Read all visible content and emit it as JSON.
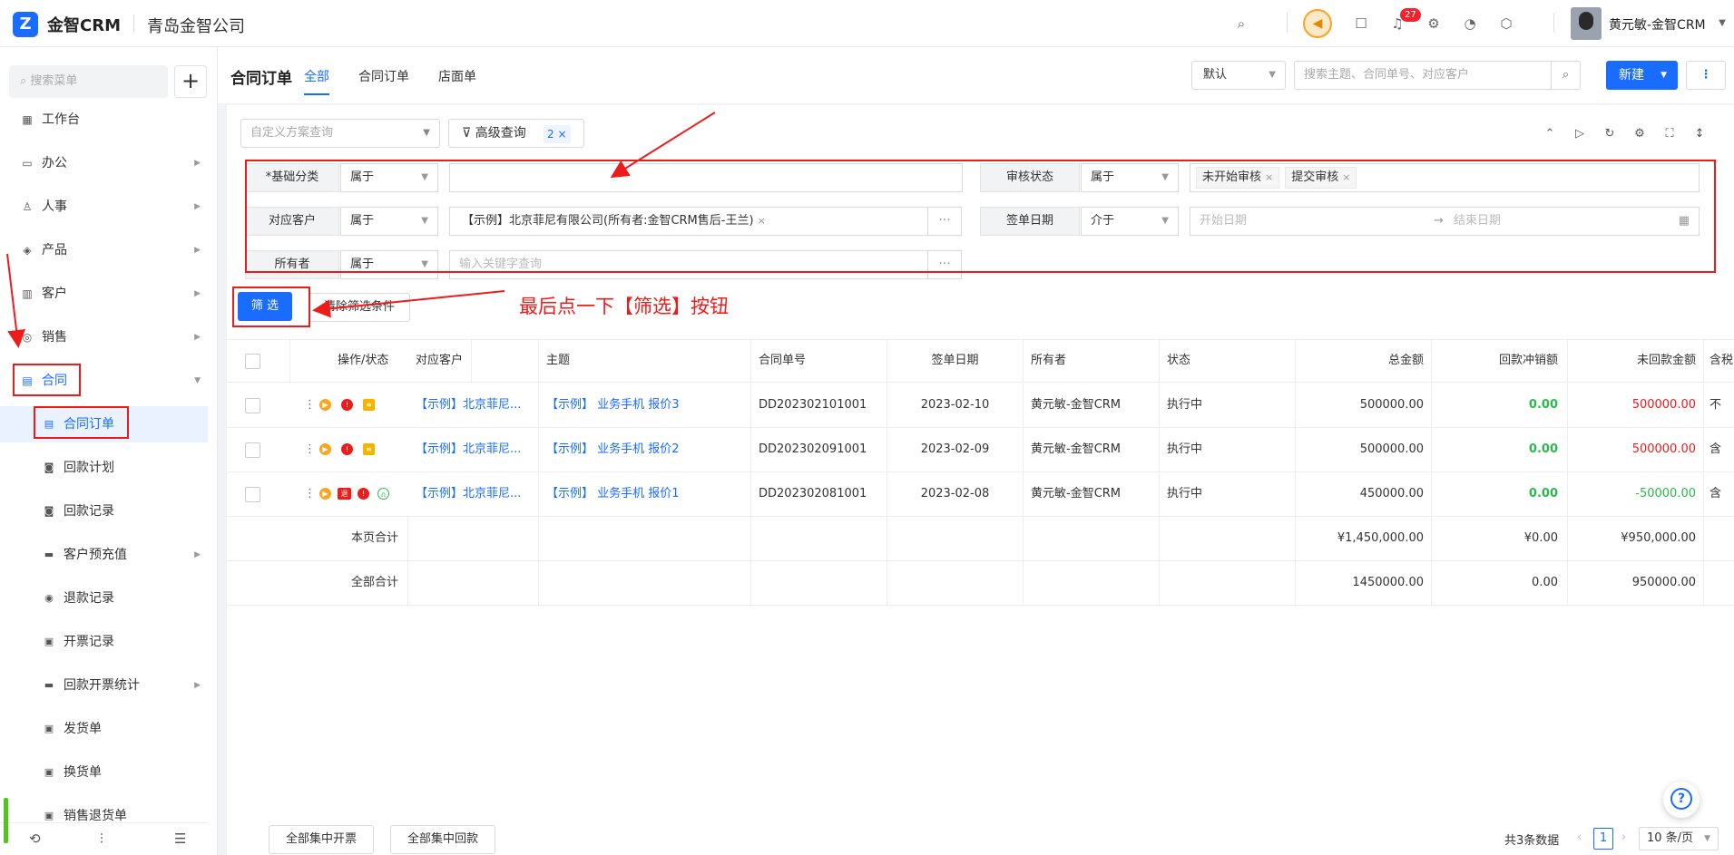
{
  "app": {
    "name": "金智CRM",
    "company": "青岛金智公司",
    "user": "黄元敏-金智CRM",
    "notif_count": "27"
  },
  "sidebar": {
    "search_placeholder": "搜索菜单",
    "items": [
      {
        "label": "工作台",
        "icon": "dashboard-icon"
      },
      {
        "label": "办公",
        "icon": "office-icon"
      },
      {
        "label": "人事",
        "icon": "people-icon"
      },
      {
        "label": "产品",
        "icon": "product-icon"
      },
      {
        "label": "客户",
        "icon": "customer-icon"
      },
      {
        "label": "销售",
        "icon": "sales-icon"
      },
      {
        "label": "合同",
        "icon": "contract-icon"
      }
    ],
    "subs": [
      {
        "label": "合同订单"
      },
      {
        "label": "回款计划"
      },
      {
        "label": "回款记录"
      },
      {
        "label": "客户预充值"
      },
      {
        "label": "退款记录"
      },
      {
        "label": "开票记录"
      },
      {
        "label": "回款开票统计"
      },
      {
        "label": "发货单"
      },
      {
        "label": "换货单"
      },
      {
        "label": "销售退货单"
      }
    ]
  },
  "header": {
    "title": "合同订单",
    "tabs": [
      {
        "label": "全部"
      },
      {
        "label": "合同订单"
      },
      {
        "label": "店面单"
      }
    ],
    "view_select": "默认",
    "search_placeholder": "搜索主题、合同单号、对应客户",
    "new_label": "新建"
  },
  "filters": {
    "scheme_placeholder": "自定义方案查询",
    "advanced_label": "高级查询",
    "advanced_count": "2",
    "rows": [
      {
        "label": "*基础分类",
        "op": "属于",
        "value": ""
      },
      {
        "label": "对应客户",
        "op": "属于",
        "value": "【示例】北京菲尼有限公司(所有者:金智CRM售后-王兰)"
      },
      {
        "label": "所有者",
        "op": "属于",
        "placeholder": "输入关键字查询"
      },
      {
        "label": "审核状态",
        "op": "属于",
        "tags": [
          "未开始审核",
          "提交审核"
        ]
      },
      {
        "label": "签单日期",
        "op": "介于",
        "start_placeholder": "开始日期",
        "end_placeholder": "结束日期"
      }
    ],
    "filter_btn": "筛 选",
    "clear_btn": "清除筛选条件",
    "annotation": "最后点一下【筛选】按钮"
  },
  "table": {
    "headers": [
      "操作/状态",
      "对应客户",
      "主题",
      "合同单号",
      "签单日期",
      "所有者",
      "状态",
      "总金额",
      "回款冲销额",
      "未回款金额",
      "含税"
    ],
    "rows": [
      {
        "customer": "【示例】北京菲尼...",
        "subject": "【示例】 业务手机 报价3",
        "no": "DD202302101001",
        "date": "2023-02-10",
        "owner": "黄元敏-金智CRM",
        "status": "执行中",
        "total": "500000.00",
        "paid": "0.00",
        "unpaid": "500000.00",
        "tax": "不"
      },
      {
        "customer": "【示例】北京菲尼...",
        "subject": "【示例】 业务手机 报价2",
        "no": "DD202302091001",
        "date": "2023-02-09",
        "owner": "黄元敏-金智CRM",
        "status": "执行中",
        "total": "500000.00",
        "paid": "0.00",
        "unpaid": "500000.00",
        "tax": "含"
      },
      {
        "customer": "【示例】北京菲尼...",
        "subject": "【示例】 业务手机 报价1",
        "no": "DD202302081001",
        "date": "2023-02-08",
        "owner": "黄元敏-金智CRM",
        "status": "执行中",
        "total": "450000.00",
        "paid": "0.00",
        "unpaid": "-50000.00",
        "tax": "含"
      }
    ],
    "page_total": {
      "label": "本页合计",
      "total": "¥1,450,000.00",
      "paid": "¥0.00",
      "unpaid": "¥950,000.00"
    },
    "all_total": {
      "label": "全部合计",
      "total": "1450000.00",
      "paid": "0.00",
      "unpaid": "950000.00"
    },
    "refund_badge": "退"
  },
  "footer": {
    "btn1": "全部集中开票",
    "btn2": "全部集中回款",
    "count": "共3条数据",
    "page": "1",
    "page_size": "10 条/页"
  },
  "colors": {
    "primary": "#1a6cff",
    "annotation": "#ee1b1b",
    "positive": "#2db84d"
  }
}
